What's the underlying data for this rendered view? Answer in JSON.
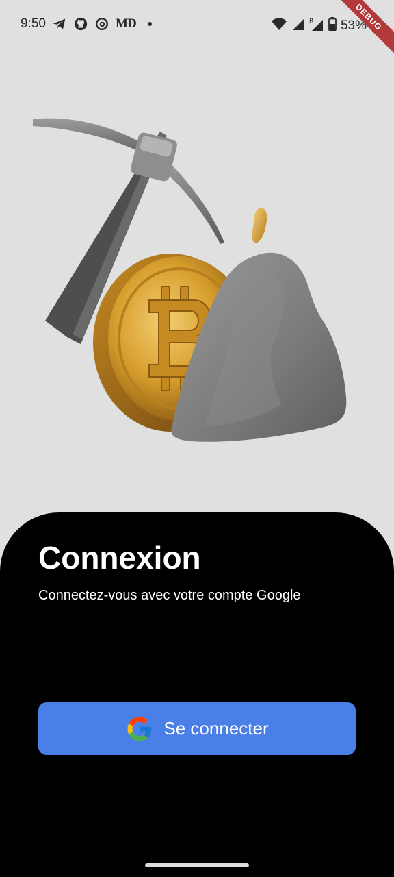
{
  "status_bar": {
    "time": "9:50",
    "medium_label": "MƉ",
    "battery_percent": "53%",
    "debug_label": "DEBUG"
  },
  "icons": {
    "telegram": "telegram-icon",
    "github": "github-icon",
    "threads": "threads-icon",
    "medium": "medium-icon",
    "wifi": "wifi-icon",
    "signal": "signal-icon",
    "roaming_signal": "roaming-signal-icon",
    "battery": "battery-icon",
    "google": "google-icon"
  },
  "hero": {
    "illustration": "pickaxe, gold bitcoin coin and grey rock"
  },
  "login": {
    "title": "Connexion",
    "subtitle": "Connectez-vous avec votre compte Google",
    "button_label": "Se connecter"
  },
  "colors": {
    "background": "#e0e0e0",
    "sheet": "#000000",
    "button": "#4b7fe8",
    "debug_banner": "#b33a3a"
  }
}
